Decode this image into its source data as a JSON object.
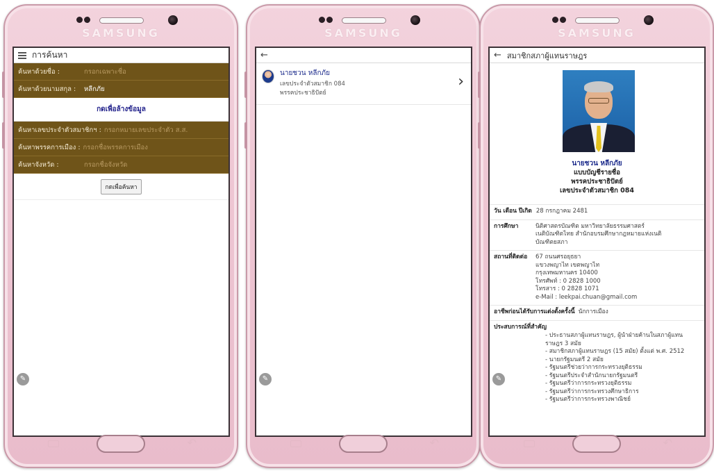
{
  "brand": "SAMSUNG",
  "colors": {
    "phone_body": "#eec6d3",
    "form_row_bg": "#6f5419",
    "link_blue": "#1d2c8c",
    "portrait_bg": "#1b5fa5"
  },
  "screen1": {
    "title": "การค้นหา",
    "rows_top": [
      {
        "label": "ค้นหาด้วยชื่อ :",
        "value": "กรอกเฉพาะชื่อ",
        "filled": false
      },
      {
        "label": "ค้นหาด้วยนามสกุล :",
        "value": "หลีกภัย",
        "filled": true
      }
    ],
    "clear_label": "กดเพื่อล้างข้อมูล",
    "rows_bottom": [
      {
        "label": "ค้นหาเลขประจำตัวสมาชิกฯ :",
        "value": "กรอกหมายเลขประจำตัว ส.ส."
      },
      {
        "label": "ค้นหาพรรคการเมือง :",
        "value": "กรอกชื่อพรรคการเมือง"
      },
      {
        "label": "ค้นหาจังหวัด :",
        "value": "กรอกชื่อจังหวัด"
      }
    ],
    "search_button": "กดเพื่อค้นหา"
  },
  "screen2": {
    "result": {
      "name": "นายชวน หลีกภัย",
      "member_no": "เลขประจำตัวสมาชิก 084",
      "party": "พรรคประชาธิปัตย์"
    }
  },
  "screen3": {
    "title": "สมาชิกสภาผู้แทนราษฎร",
    "name": "นายชวน หลีกภัย",
    "type": "แบบบัญชีรายชื่อ",
    "party": "พรรคประชาธิปัตย์",
    "member_no": "เลขประจำตัวสมาชิก 084",
    "birth_label": "วัน เดือน ปีเกิด",
    "birth_value": "28 กรกฎาคม 2481",
    "edu_label": "การศึกษา",
    "edu_lines": [
      "นิติศาสตรบัณฑิต มหาวิทยาลัยธรรมศาสตร์",
      "เนติบัณฑิตไทย สำนักอบรมศึกษากฎหมายแห่งเนติ",
      "บัณฑิตยสภา"
    ],
    "contact_label": "สถานที่ติดต่อ",
    "contact_lines": [
      "67 ถนนศรอยุธยา",
      "แขวงพญาไท เขตพญาไท",
      "กรุงเทพมหานคร 10400",
      "โทรศัพท์ : 0 2828 1000",
      "โทรสาร : 0 2828 1071",
      "e-Mail : leekpai.chuan@gmail.com"
    ],
    "occupation_label": "อาชีพก่อนได้รับการแต่งตั้งครั้งนี้",
    "occupation_value": "นักการเมือง",
    "experience_label": "ประสบการณ์ที่สำคัญ",
    "experience_lines": [
      "- ประธานสภาผู้แทนราษฎร, ผู้นำฝ่ายค้านในสภาผู้แทน",
      "ราษฎร 3 สมัย",
      "- สมาชิกสภาผู้แทนราษฎร (15 สมัย) ตั้งแต่ พ.ศ. 2512",
      "- นายกรัฐมนตรี 2 สมัย",
      "- รัฐมนตรีช่วยว่าการกระทรวงยุติธรรม",
      "- รัฐมนตรีประจำสำนักนายกรัฐมนตรี",
      "- รัฐมนตรีว่าการกระทรวงยุติธรรม",
      "- รัฐมนตรีว่าการกระทรวงศึกษาธิการ",
      "- รัฐมนตรีว่าการกระทรวงพาณิชย์"
    ]
  }
}
